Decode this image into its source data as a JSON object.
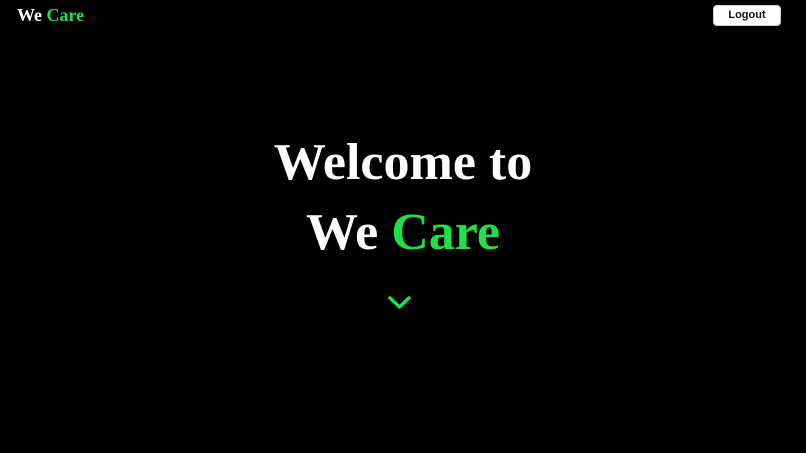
{
  "navbar": {
    "brand_first": "We",
    "brand_second": "Care",
    "logout_label": "Logout"
  },
  "hero": {
    "line1": "Welcome to",
    "line2_first": "We",
    "line2_second": "Care"
  },
  "icons": {
    "scroll_down": "chevron-down-icon"
  },
  "colors": {
    "background": "#000000",
    "accent": "#1fe046",
    "text": "#ffffff"
  }
}
